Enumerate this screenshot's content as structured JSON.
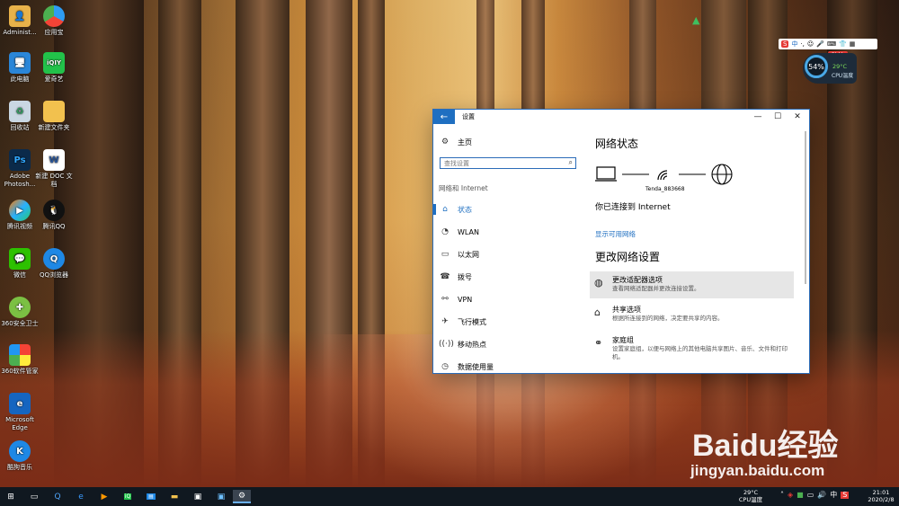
{
  "desktop": {
    "icons": [
      {
        "label": "Administ...",
        "icon": "folder-user-icon"
      },
      {
        "label": "应用宝",
        "icon": "app-store-icon"
      },
      {
        "label": "此电脑",
        "icon": "computer-icon"
      },
      {
        "label": "爱奇艺",
        "icon": "iqiyi-icon"
      },
      {
        "label": "回收站",
        "icon": "recycle-bin-icon"
      },
      {
        "label": "新建文件夹",
        "icon": "folder-icon"
      },
      {
        "label": "Adobe Photosh...",
        "icon": "photoshop-icon"
      },
      {
        "label": "新建 DOC 文档",
        "icon": "doc-file-icon"
      },
      {
        "label": "腾讯视频",
        "icon": "tencent-video-icon"
      },
      {
        "label": "腾讯QQ",
        "icon": "qq-icon"
      },
      {
        "label": "微信",
        "icon": "wechat-icon"
      },
      {
        "label": "QQ浏览器",
        "icon": "qq-browser-icon"
      },
      {
        "label": "360安全卫士",
        "icon": "360-security-icon"
      },
      {
        "label": "360软件管家",
        "icon": "360-software-icon"
      },
      {
        "label": "Microsoft Edge",
        "icon": "edge-icon"
      },
      {
        "label": "酷狗音乐",
        "icon": "kugou-icon"
      }
    ]
  },
  "window": {
    "title": "设置",
    "nav": {
      "home": "主页",
      "search_placeholder": "查找设置",
      "section": "网络和 Internet",
      "items": [
        "状态",
        "WLAN",
        "以太网",
        "拨号",
        "VPN",
        "飞行模式",
        "移动热点",
        "数据使用量"
      ],
      "selected": "状态"
    },
    "content": {
      "status_heading": "网络状态",
      "network_name": "Tenda_883668",
      "connected_text": "你已连接到 Internet",
      "show_networks_link": "显示可用网络",
      "change_heading": "更改网络设置",
      "options": [
        {
          "title": "更改适配器选项",
          "desc": "查看网络适配器并更改连接设置。",
          "icon": "adapter-icon"
        },
        {
          "title": "共享选项",
          "desc": "根据所连接到的网络，决定要共享的内容。",
          "icon": "sharing-icon"
        },
        {
          "title": "家庭组",
          "desc": "设置家庭组，以便与网络上的其他电脑共享图片、音乐、文件和打印机。",
          "icon": "homegroup-icon"
        }
      ]
    }
  },
  "widgets": {
    "ime": "中",
    "protect_badge": "防护",
    "cpu_percent": "54%",
    "cpu_temp": "29°C",
    "cpu_label": "CPU温度"
  },
  "watermark": {
    "brand": "Baidu经验",
    "url": "jingyan.baidu.com"
  },
  "taskbar": {
    "cpu_temp": "29°C",
    "cpu_label": "CPU温度",
    "ime": "中",
    "time": "21:01",
    "date": "2020/2/8"
  },
  "colors": {
    "accent": "#1f6fc1",
    "taskbar": "#101820"
  }
}
